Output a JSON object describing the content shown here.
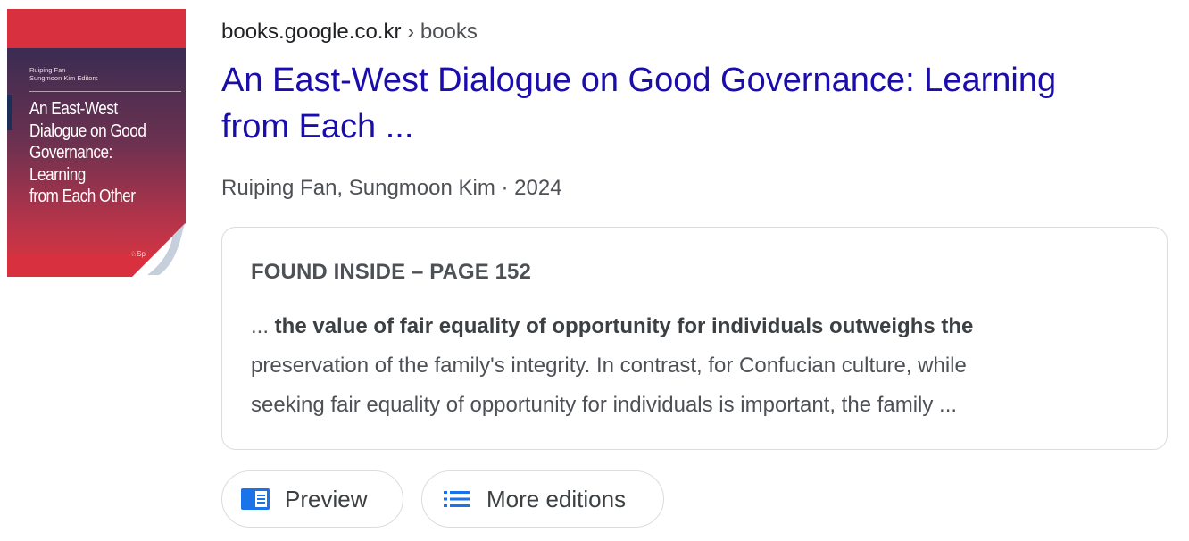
{
  "result": {
    "breadcrumb": {
      "domain": "books.google.co.kr",
      "separator": "›",
      "path": "books"
    },
    "title_lines": [
      "An East-West Dialogue on Good Governance: Learning",
      "from Each ..."
    ],
    "byline": "Ruiping Fan, Sungmoon Kim · 2024",
    "cover": {
      "editors": [
        "Ruiping Fan",
        "Sungmoon Kim  Editors"
      ],
      "title_lines": [
        "An East-West",
        "Dialogue on Good",
        "Governance:",
        "Learning",
        "from Each Other"
      ],
      "publisher_mark": "Sp",
      "colors": {
        "background": "#d8303f",
        "band_top": "#3a2c52",
        "spine_mark": "#1c2d56"
      }
    },
    "snippet": {
      "found_inside": "FOUND INSIDE – PAGE 152",
      "lead": "... ",
      "bold": "the value of fair equality of opportunity for individuals outweighs the",
      "line2": "preservation of the family's integrity. In contrast, for Confucian culture, while",
      "line3": "seeking fair equality of opportunity for individuals is important, the family ..."
    },
    "actions": {
      "preview": {
        "label": "Preview",
        "icon": "book-preview-icon"
      },
      "more_editions": {
        "label": "More editions",
        "icon": "list-icon"
      }
    },
    "colors": {
      "link": "#1a0dab",
      "text_secondary": "#4d5156",
      "icon_blue": "#1a73e8",
      "border": "#dadce0"
    }
  }
}
